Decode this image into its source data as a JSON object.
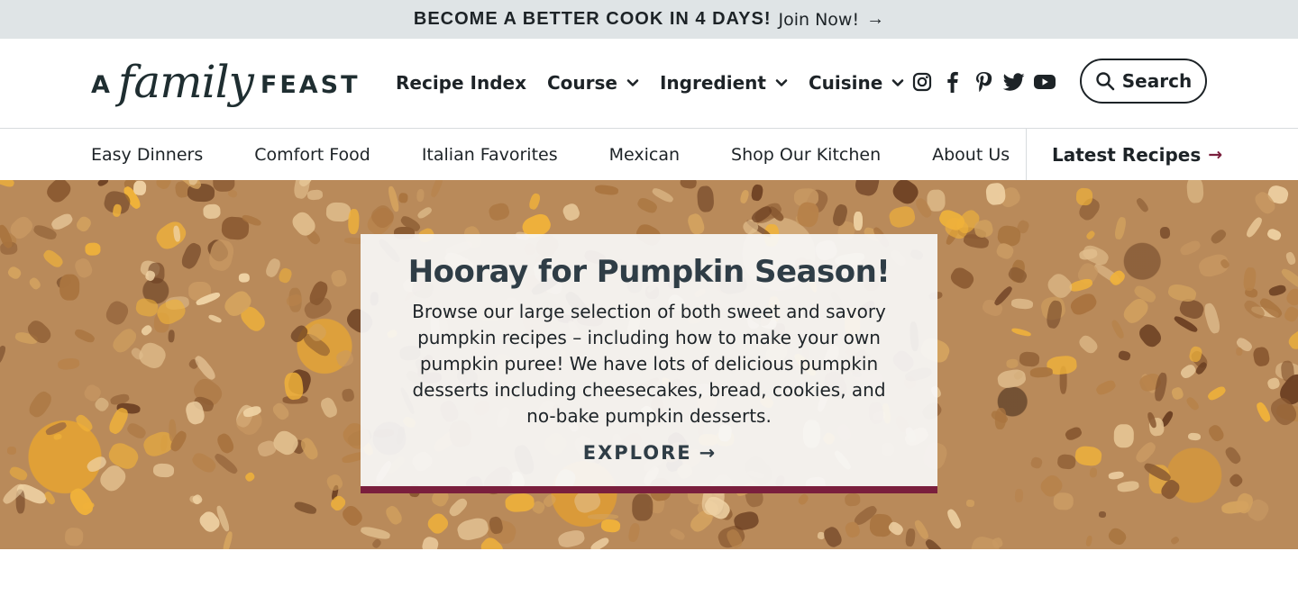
{
  "promo": {
    "headline": "BECOME A BETTER COOK IN 4 DAYS!",
    "cta": "Join Now!",
    "arrow": "→"
  },
  "brand": {
    "a": "A",
    "family": "family",
    "feast": "FEAST"
  },
  "main_nav": {
    "recipe_index": "Recipe Index",
    "course": "Course",
    "ingredient": "Ingredient",
    "cuisine": "Cuisine"
  },
  "social": {
    "icons": [
      "instagram-icon",
      "facebook-icon",
      "pinterest-icon",
      "twitter-icon",
      "youtube-icon"
    ]
  },
  "search": {
    "label": "Search"
  },
  "sub_nav": {
    "items": [
      "Easy Dinners",
      "Comfort Food",
      "Italian Favorites",
      "Mexican",
      "Shop Our Kitchen",
      "About Us"
    ],
    "latest": "Latest Recipes",
    "latest_arrow": "→"
  },
  "hero": {
    "title": "Hooray for Pumpkin Season!",
    "body": "Browse our large selection of both sweet and savory pumpkin recipes – including how to make your own pumpkin puree! We have lots of delicious pumpkin desserts including cheesecakes, bread, cookies, and no-bake pumpkin desserts.",
    "cta": "EXPLORE",
    "cta_arrow": "→"
  },
  "colors": {
    "accent": "#7a1f3d",
    "text": "#1d2327",
    "promo_bg": "#dfe4e6"
  }
}
